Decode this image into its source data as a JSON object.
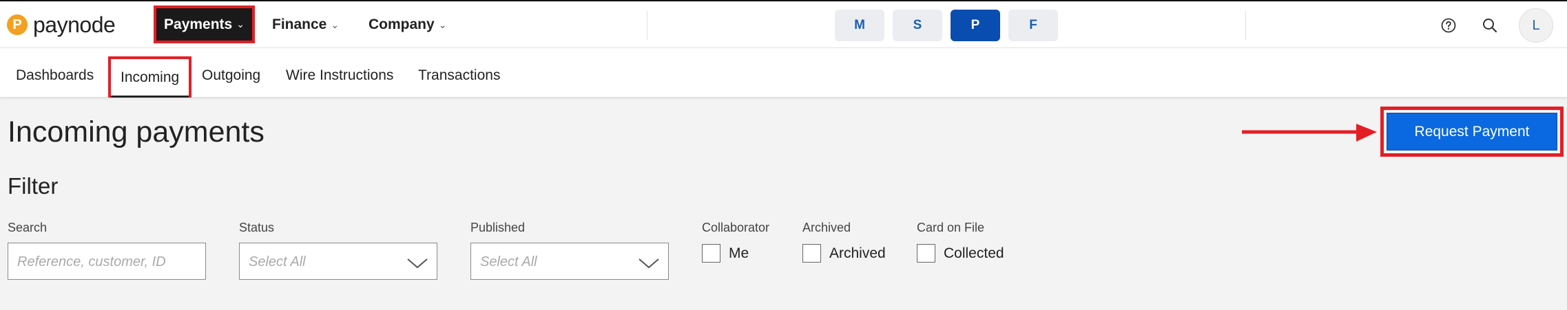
{
  "brand": {
    "name": "paynode",
    "mark": "P",
    "color": "#f4a020"
  },
  "topnav": {
    "payments": "Payments",
    "finance": "Finance",
    "company": "Company"
  },
  "apps": [
    "M",
    "S",
    "P",
    "F"
  ],
  "active_app": "P",
  "user": {
    "initial": "L"
  },
  "subnav": {
    "dashboards": "Dashboards",
    "incoming": "Incoming",
    "outgoing": "Outgoing",
    "wire": "Wire Instructions",
    "transactions": "Transactions"
  },
  "page": {
    "title": "Incoming payments",
    "filter_title": "Filter",
    "request_button": "Request Payment"
  },
  "filters": {
    "search": {
      "label": "Search",
      "placeholder": "Reference, customer, ID"
    },
    "status": {
      "label": "Status",
      "placeholder": "Select All"
    },
    "published": {
      "label": "Published",
      "placeholder": "Select All"
    },
    "collaborator": {
      "label": "Collaborator",
      "option": "Me"
    },
    "archived": {
      "label": "Archived",
      "option": "Archived"
    },
    "card_on_file": {
      "label": "Card on File",
      "option": "Collected"
    }
  },
  "colors": {
    "accent": "#0a68e0",
    "highlight": "#e41e25",
    "active_app": "#0a4db0"
  }
}
